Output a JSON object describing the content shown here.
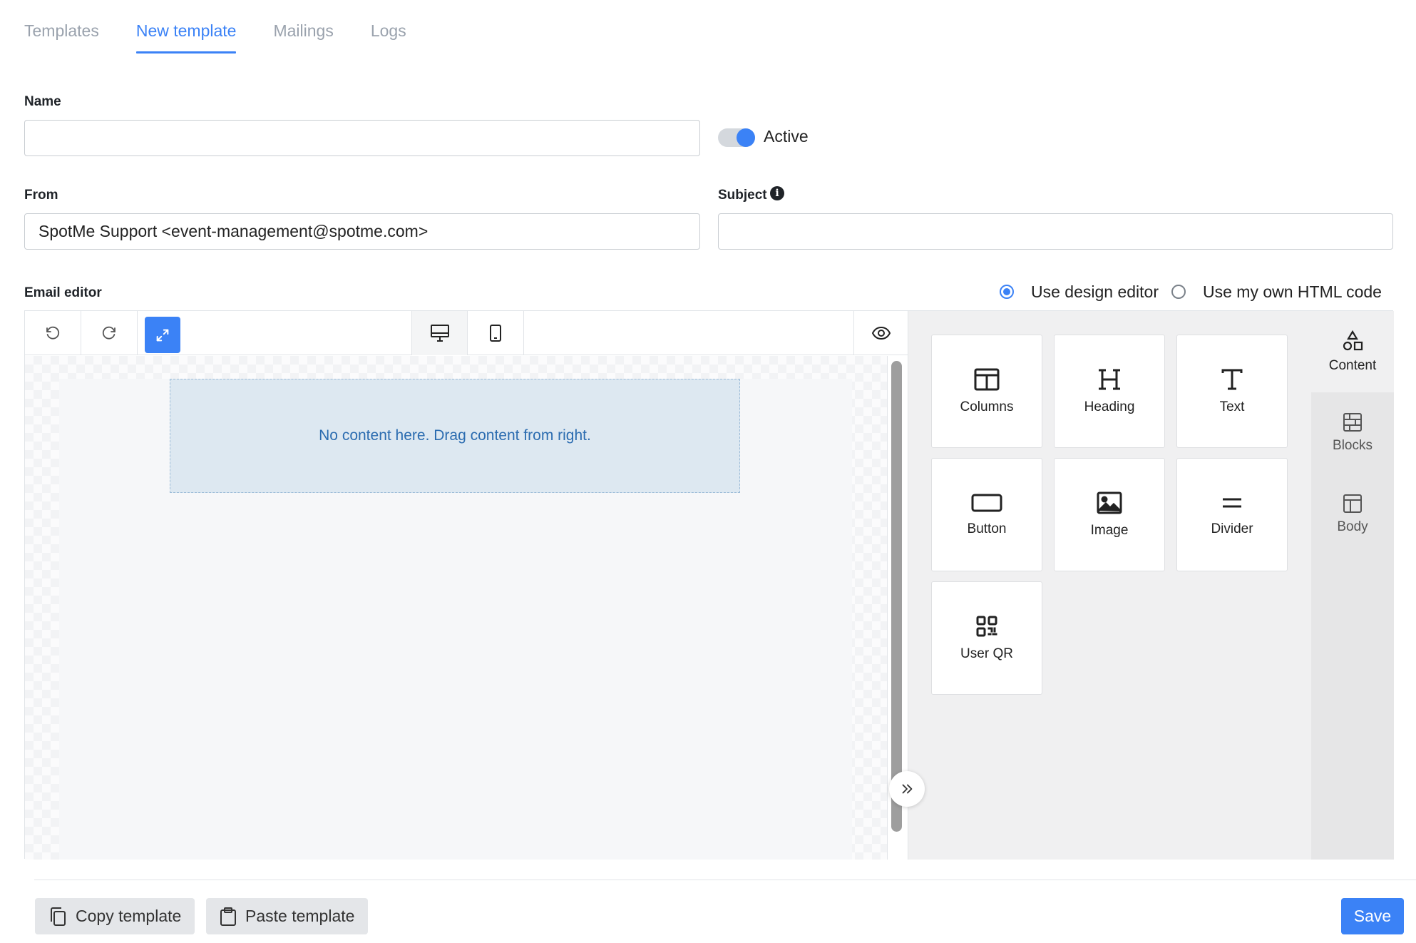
{
  "tabs": [
    {
      "label": "Templates"
    },
    {
      "label": "New template"
    },
    {
      "label": "Mailings"
    },
    {
      "label": "Logs"
    }
  ],
  "form": {
    "name_label": "Name",
    "name_value": "",
    "active_label": "Active",
    "from_label": "From",
    "from_value": "SpotMe Support <event-management@spotme.com>",
    "subject_label": "Subject",
    "subject_value": ""
  },
  "editor": {
    "label": "Email editor",
    "mode_design": "Use design editor",
    "mode_html": "Use my own HTML code",
    "empty_message": "No content here. Drag content from right."
  },
  "content_tiles": [
    {
      "label": "Columns",
      "icon": "columns-icon"
    },
    {
      "label": "Heading",
      "icon": "heading-icon"
    },
    {
      "label": "Text",
      "icon": "text-icon"
    },
    {
      "label": "Button",
      "icon": "button-icon"
    },
    {
      "label": "Image",
      "icon": "image-icon"
    },
    {
      "label": "Divider",
      "icon": "divider-icon"
    },
    {
      "label": "User QR",
      "icon": "qr-code-icon"
    }
  ],
  "sidebar": [
    {
      "label": "Content",
      "icon": "shapes-icon"
    },
    {
      "label": "Blocks",
      "icon": "blocks-icon"
    },
    {
      "label": "Body",
      "icon": "body-layout-icon"
    }
  ],
  "footer": {
    "copy_label": "Copy template",
    "paste_label": "Paste template",
    "save_label": "Save"
  },
  "colors": {
    "accent": "#3b82f6",
    "drop_zone": "#dde8f1"
  }
}
